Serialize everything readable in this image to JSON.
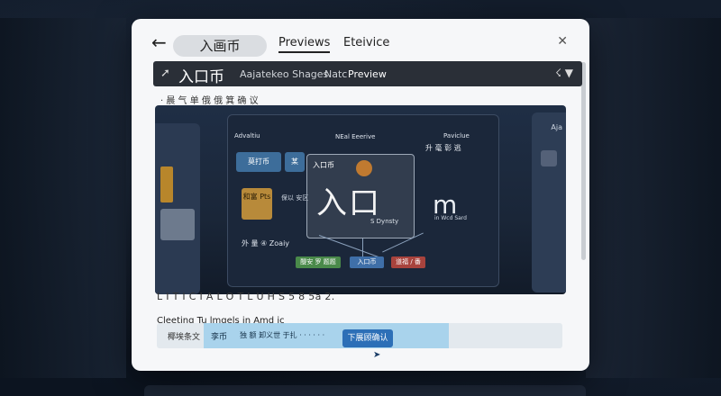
{
  "dialog": {
    "search_value": "入画币",
    "tabs": [
      "Previews",
      "Eteivice"
    ],
    "toolbar": {
      "title": "入口币",
      "shapes_label": "Aajatekeo Shages",
      "natc_label": "Natc",
      "preview_label": "Preview"
    },
    "subtitle": "· 晨 气 单 俄 俄   箕 确 议",
    "preview": {
      "label_left": "Advaltiu",
      "label_mid": "NEal Eeerive",
      "label_right": "Paviclue",
      "box1": "莫打币",
      "box1b": "某",
      "box2": "和富 Pts",
      "mid_text": "保以 安区",
      "center_small": "入口币",
      "center_big": "入口",
      "center_sub": "S Dynsty",
      "right_card": "升 毫  彰 逃",
      "right_big": "m",
      "right_small": "in Wcd Sard",
      "lower_text": "外 量 ④  Zoaiy",
      "btn_green": "醍安 罗 题题",
      "btn_blue": "入口币",
      "btn_red": "道福 / 番",
      "right_panel_text": "Aja"
    },
    "caption_1": "L I T I C I A L O T L U H S 5 8 5a 2.",
    "caption_2": "Cleeting Tu lmgels in Amd ic",
    "bottombar": {
      "label": "椰埃条文",
      "text1": "孪币",
      "text2": "独 额 卸义世 于扎 · · · · · ·",
      "button": "下展顾确认"
    }
  }
}
